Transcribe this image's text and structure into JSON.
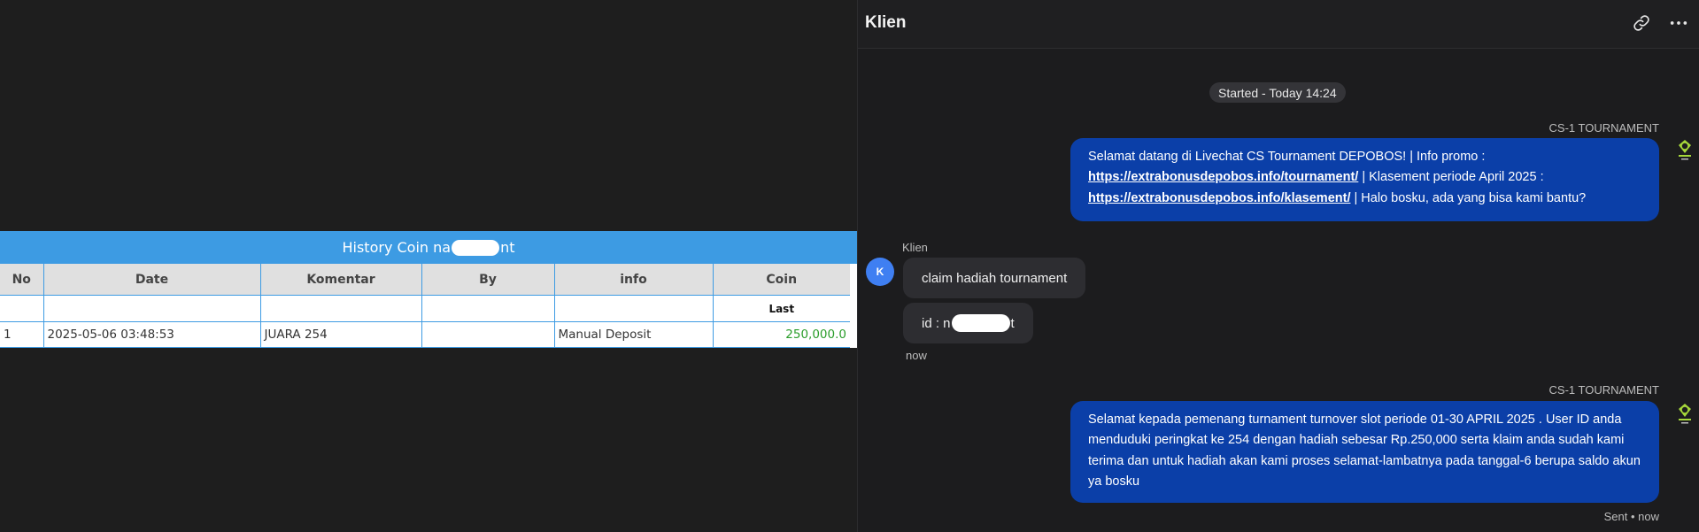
{
  "history": {
    "title_prefix": "History Coin na",
    "title_suffix": "nt",
    "columns": [
      "No",
      "Date",
      "Komentar",
      "By",
      "info",
      "Coin"
    ],
    "subheader": "Last",
    "rows": [
      {
        "no": "1",
        "date": "2025-05-06 03:48:53",
        "komentar": "JUARA 254",
        "by": "",
        "info": "Manual Deposit",
        "coin": "250,000.0"
      }
    ]
  },
  "chat": {
    "title": "Klien",
    "started": "Started - Today 14:24",
    "messages": [
      {
        "sender": "CS-1 TOURNAMENT",
        "parts": [
          {
            "type": "text",
            "value": "Selamat datang di Livechat CS Tournament DEPOBOS! | Info promo : "
          },
          {
            "type": "link",
            "value": "https://extrabonusdepobos.info/tournament/"
          },
          {
            "type": "text",
            "value": " | Klasement periode April 2025 : "
          },
          {
            "type": "link",
            "value": "https://extrabonusdepobos.info/klasement/"
          },
          {
            "type": "text",
            "value": " | Halo bosku, ada yang bisa kami bantu?"
          }
        ]
      },
      {
        "sender": "Klien",
        "avatar_letter": "K",
        "bubbles": [
          "claim hadiah tournament"
        ],
        "id_prefix": "id : n",
        "id_suffix": "t",
        "time": "now"
      },
      {
        "sender": "CS-1 TOURNAMENT",
        "text": "Selamat kepada pemenang turnament turnover slot periode 01-30 APRIL 2025 . User ID anda menduduki peringkat ke 254 dengan hadiah sebesar Rp.250,000 serta klaim anda sudah kami terima dan untuk hadiah akan kami proses selamat-lambatnya pada tanggal-6 berupa saldo akun ya bosku",
        "status": "Sent • now"
      }
    ]
  },
  "icons": {
    "link": "link-icon",
    "more": "more-options-icon",
    "bot_avatar": "depobos-logo-icon"
  },
  "colors": {
    "agent_bubble": "#0b3fa8",
    "table_header": "#3d9be3",
    "coin_value": "#2a9d2a",
    "client_avatar": "#3f7ff2"
  }
}
